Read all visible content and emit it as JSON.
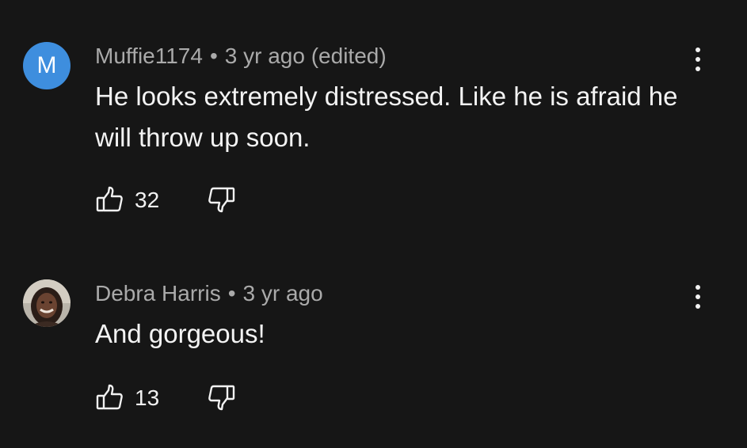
{
  "comments": [
    {
      "author": "Muffie1174",
      "avatar_letter": "M",
      "time": "3 yr ago",
      "edited": "(edited)",
      "text": "He looks extremely distressed. Like he is afraid he will throw up soon.",
      "likes": "32"
    },
    {
      "author": "Debra Harris",
      "time": "3 yr ago",
      "text": "And gorgeous!",
      "likes": "13"
    }
  ],
  "separator": "•",
  "icons": {
    "like": "thumbs-up-icon",
    "dislike": "thumbs-down-icon",
    "menu": "more-vertical-icon"
  },
  "colors": {
    "background": "#161616",
    "avatar_blue": "#3e8ede",
    "meta_gray": "#aaaaaa",
    "text": "#f1f1f1"
  }
}
